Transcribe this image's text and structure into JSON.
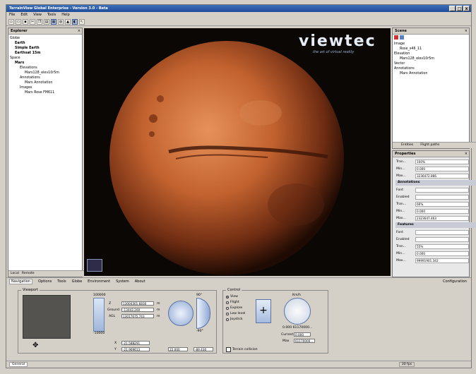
{
  "window": {
    "title": "TerrainView Global Enterprise - Version 3.0 - Beta",
    "controls": [
      "_",
      "□",
      "x"
    ]
  },
  "menu": [
    "File",
    "Edit",
    "View",
    "Tools",
    "Help"
  ],
  "toolbar_icons": [
    "new-icon",
    "open-icon",
    "save-icon",
    "cut-icon",
    "copy-icon",
    "paste-icon",
    "select-icon",
    "globe-icon",
    "terrain-icon",
    "layer-icon",
    "pointer-icon"
  ],
  "explorer": {
    "title": "Explorer",
    "items": [
      {
        "label": "Globe",
        "indent": 0,
        "bold": false
      },
      {
        "label": "Earth",
        "indent": 1,
        "bold": true
      },
      {
        "label": "Simple Earth",
        "indent": 1,
        "bold": true
      },
      {
        "label": "Earthsat 15m",
        "indent": 1,
        "bold": true
      },
      {
        "label": "Space",
        "indent": 0,
        "bold": false
      },
      {
        "label": "Mars",
        "indent": 1,
        "bold": true
      },
      {
        "label": "Elevations",
        "indent": 2,
        "bold": false
      },
      {
        "label": "Mars128_elev10r5m",
        "indent": 3,
        "bold": false
      },
      {
        "label": "Annotations",
        "indent": 2,
        "bold": false
      },
      {
        "label": "Mars Annotation",
        "indent": 3,
        "bold": false
      },
      {
        "label": "Images",
        "indent": 2,
        "bold": false
      },
      {
        "label": "Mars Rose FM611",
        "indent": 3,
        "bold": false
      }
    ],
    "tabs": [
      "Local",
      "Remote"
    ]
  },
  "logo": {
    "brand": "viewtec",
    "tagline": "the art of virtual reality"
  },
  "scene": {
    "title": "Scene",
    "items": [
      {
        "label": "Image",
        "indent": 0
      },
      {
        "label": "Rose_s46_11",
        "indent": 1
      },
      {
        "label": "Elevation",
        "indent": 0
      },
      {
        "label": "Mars128_elev10r5m",
        "indent": 1
      },
      {
        "label": "Vector",
        "indent": 0
      },
      {
        "label": "Annotations",
        "indent": 0
      },
      {
        "label": "Mars Annotation",
        "indent": 1
      }
    ],
    "tabs": [
      "Entities",
      "Flight paths"
    ]
  },
  "properties": {
    "title": "Properties",
    "rows": [
      {
        "type": "row",
        "key": "Tran...",
        "value": "100%"
      },
      {
        "type": "row",
        "key": "Min...",
        "value": "0.000"
      },
      {
        "type": "row",
        "key": "Max...",
        "value": "3236472.866"
      },
      {
        "type": "group",
        "key": "Annotations"
      },
      {
        "type": "row",
        "key": "Font",
        "value": ""
      },
      {
        "type": "row",
        "key": "Enabled",
        "value": ""
      },
      {
        "type": "row",
        "key": "Tran...",
        "value": "66%"
      },
      {
        "type": "row",
        "key": "Min...",
        "value": "0.000"
      },
      {
        "type": "row",
        "key": "Max...",
        "value": "2323647.463"
      },
      {
        "type": "group",
        "key": "Features"
      },
      {
        "type": "row",
        "key": "Font",
        "value": ""
      },
      {
        "type": "row",
        "key": "Enabled",
        "value": ""
      },
      {
        "type": "row",
        "key": "Tran...",
        "value": "55%"
      },
      {
        "type": "row",
        "key": "Min...",
        "value": "0.000"
      },
      {
        "type": "row",
        "key": "Max...",
        "value": "99991901.342"
      }
    ]
  },
  "bottom_tabs": [
    "Navigation",
    "Options",
    "Tools",
    "Globe",
    "Environment",
    "System",
    "About"
  ],
  "configuration": "Configuration",
  "viewport_group": {
    "label": "Viewport",
    "z_label": "Z",
    "z_value": "13004301.6830",
    "ground_label": "Ground",
    "ground_value": "-13043.200",
    "agl_label": "AGL",
    "agl_value": "13017675.743",
    "unit": "m",
    "slider_top": "100000",
    "slider_bottom": "-10000",
    "x_label": "X",
    "x_value": "-21.588291",
    "y_label": "Y",
    "y_value": "-21.969613",
    "heading_value": "22.000",
    "pitch_value": "-89.430",
    "pitch_top": "90°",
    "pitch_bottom": "-90°"
  },
  "control_group": {
    "label": "Control",
    "modes": [
      "View",
      "Flight",
      "Explore",
      "Low level",
      "Joystick"
    ],
    "selected": "View",
    "speed_label": "Km/h",
    "speed_range": "0.000 61170000...",
    "current_label": "Current",
    "current_value": "0.000",
    "max_label": "Max",
    "max_value": "61170000...",
    "terrain_collision": "Terrain collision"
  },
  "status": {
    "tab": "General",
    "fps": "30 fps"
  },
  "colors": {
    "title": "#2b5aa6",
    "panel": "#d4d0c8",
    "viewport": "#0a0705",
    "mars": "#b8582c"
  }
}
